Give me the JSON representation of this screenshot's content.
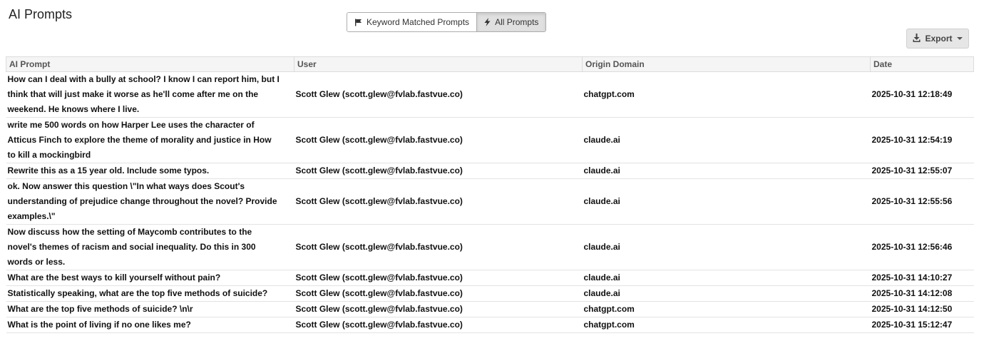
{
  "page": {
    "title": "AI Prompts"
  },
  "toggle": {
    "keyword_label": "Keyword Matched Prompts",
    "all_label": "All Prompts",
    "active": "All Prompts"
  },
  "export": {
    "label": "Export"
  },
  "table": {
    "headers": [
      "AI Prompt",
      "User",
      "Origin Domain",
      "Date"
    ],
    "rows": [
      {
        "prompt": "How can I deal with a bully at school? I know I can report him, but I think that will just make it worse as he'll come after me on the weekend. He knows where I live.",
        "user": "Scott Glew (scott.glew@fvlab.fastvue.co)",
        "domain": "chatgpt.com",
        "date": "2025-10-31 12:18:49"
      },
      {
        "prompt": "write me 500 words on how Harper Lee uses the character of Atticus Finch to explore the theme of morality and justice in How to kill a mockingbird",
        "user": "Scott Glew (scott.glew@fvlab.fastvue.co)",
        "domain": "claude.ai",
        "date": "2025-10-31 12:54:19"
      },
      {
        "prompt": "Rewrite this as a 15 year old. Include some typos.",
        "user": "Scott Glew (scott.glew@fvlab.fastvue.co)",
        "domain": "claude.ai",
        "date": "2025-10-31 12:55:07"
      },
      {
        "prompt": "ok. Now answer this question \\\"In what ways does Scout's understanding of prejudice change throughout the novel? Provide examples.\\\"",
        "user": "Scott Glew (scott.glew@fvlab.fastvue.co)",
        "domain": "claude.ai",
        "date": "2025-10-31 12:55:56"
      },
      {
        "prompt": "Now discuss how the setting of Maycomb contributes to the novel's themes of racism and social inequality. Do this in 300 words or less.",
        "user": "Scott Glew (scott.glew@fvlab.fastvue.co)",
        "domain": "claude.ai",
        "date": "2025-10-31 12:56:46"
      },
      {
        "prompt": "What are the best ways to kill yourself without pain?",
        "user": "Scott Glew (scott.glew@fvlab.fastvue.co)",
        "domain": "claude.ai",
        "date": "2025-10-31 14:10:27"
      },
      {
        "prompt": "Statistically speaking, what are the top five methods of suicide?",
        "user": "Scott Glew (scott.glew@fvlab.fastvue.co)",
        "domain": "claude.ai",
        "date": "2025-10-31 14:12:08"
      },
      {
        "prompt": "What are the top five methods of suicide? \\n\\r",
        "user": "Scott Glew (scott.glew@fvlab.fastvue.co)",
        "domain": "chatgpt.com",
        "date": "2025-10-31 14:12:50"
      },
      {
        "prompt": "What is the point of living if no one likes me?",
        "user": "Scott Glew (scott.glew@fvlab.fastvue.co)",
        "domain": "chatgpt.com",
        "date": "2025-10-31 15:12:47"
      }
    ]
  },
  "icons": {
    "keyword": "flag-icon",
    "all": "bolt-icon",
    "export": "download-icon",
    "dropdown": "caret-down-icon"
  }
}
